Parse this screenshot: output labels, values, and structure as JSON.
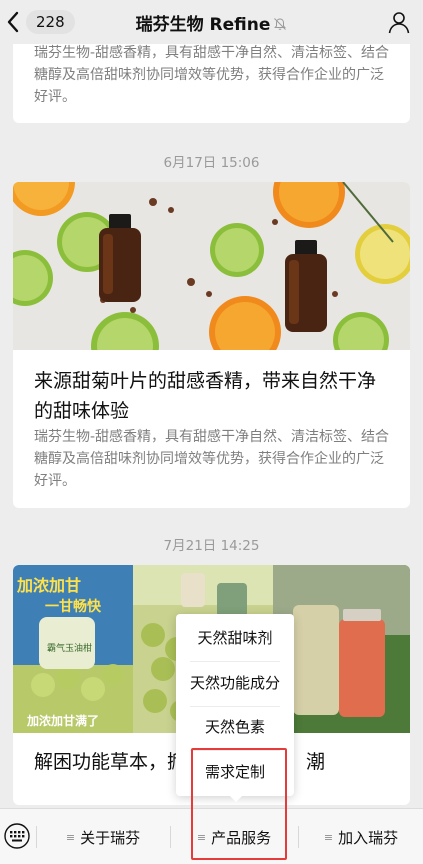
{
  "header": {
    "unread_count": "228",
    "title": "瑞芬生物 Refine"
  },
  "messages": [
    {
      "summary": "瑞芬生物-甜感香精，具有甜感干净自然、清洁标签、结合糖醇及高倍甜味剂协同增效等优势，获得合作企业的广泛好评。"
    },
    {
      "time": "6月17日 15:06",
      "title": "来源甜菊叶片的甜感香精，带来自然干净的甜味体验",
      "summary": "瑞芬生物-甜感香精，具有甜感干净自然、清洁标签、结合糖醇及高倍甜味剂协同增效等优势，获得合作企业的广泛好评。"
    },
    {
      "time": "7月21日 14:25",
      "title": "解困功能草本，掀",
      "title_tail": "潮",
      "poster_text_top": "加浓加甘",
      "poster_text_top2": "一甘畅快",
      "poster_text_product": "霸气玉油柑",
      "poster_text_bottom": "加浓加甘满了"
    }
  ],
  "popup_menu": {
    "items": [
      "天然甜味剂",
      "天然功能成分",
      "天然色素",
      "需求定制"
    ]
  },
  "menubar": {
    "items": [
      "关于瑞芬",
      "产品服务",
      "加入瑞芬"
    ]
  },
  "colors": {
    "background": "#ededed",
    "highlight": "#e53b3b"
  }
}
